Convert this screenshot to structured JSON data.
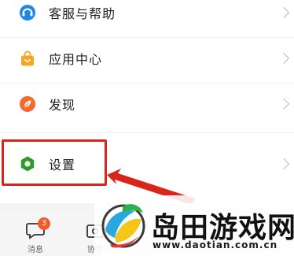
{
  "menu": {
    "items": [
      {
        "label": "客服与帮助",
        "icon": "headset-icon",
        "color": "#1e88e5"
      },
      {
        "label": "应用中心",
        "icon": "shopping-bag-icon",
        "color": "#f5a623"
      },
      {
        "label": "发现",
        "icon": "compass-leaf-icon",
        "color": "#f26b2c"
      },
      {
        "label": "设置",
        "icon": "gear-icon",
        "color": "#2e9b2a"
      }
    ]
  },
  "tabbar": {
    "messages": {
      "label": "消息",
      "badge": "3"
    },
    "collab": {
      "label": "协作"
    }
  },
  "watermark": {
    "title": "岛田游戏网",
    "url": "www.daotian.com.cn"
  },
  "colors": {
    "highlight": "#d9261c",
    "arrow": "#d9261c"
  }
}
